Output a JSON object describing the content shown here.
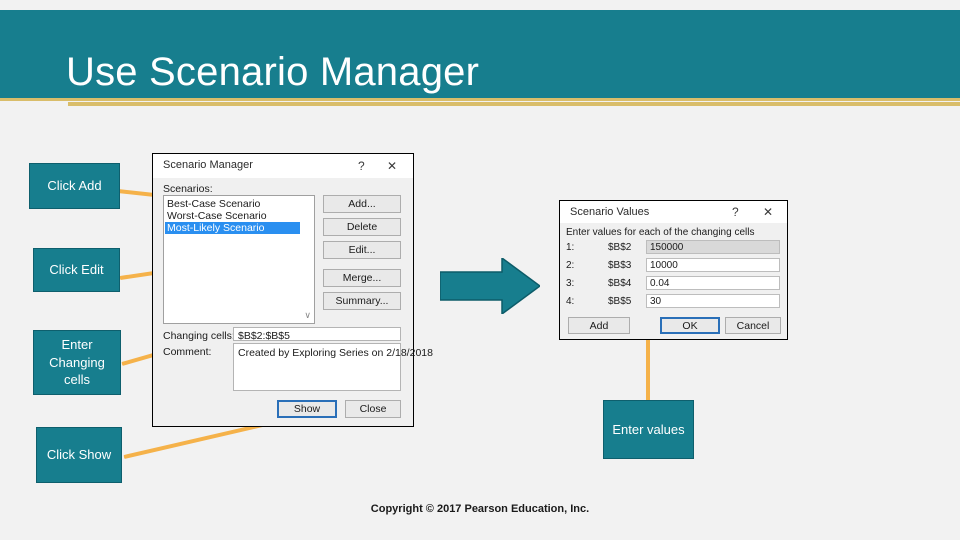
{
  "slide": {
    "title": "Use Scenario Manager",
    "copyright": "Copyright © 2017 Pearson Education, Inc.",
    "accent_teal": "#177E8E",
    "accent_gold": "#d9bd6a",
    "connector_color": "#f5b24a"
  },
  "callouts": [
    {
      "id": "click-add",
      "label": "Click Add"
    },
    {
      "id": "click-edit",
      "label": "Click Edit"
    },
    {
      "id": "enter-changing",
      "label": "Enter Changing cells"
    },
    {
      "id": "click-show",
      "label": "Click Show"
    },
    {
      "id": "enter-values",
      "label": "Enter values"
    }
  ],
  "scenario_manager": {
    "title": "Scenario Manager",
    "help_glyph": "?",
    "close_glyph": "✕",
    "scenarios_label": "Scenarios:",
    "scenarios": [
      {
        "name": "Best-Case Scenario",
        "selected": false
      },
      {
        "name": "Worst-Case Scenario",
        "selected": false
      },
      {
        "name": "Most-Likely Scenario",
        "selected": true
      }
    ],
    "scroll_glyph": "∨",
    "buttons": [
      {
        "label": "Add...",
        "accel": "A"
      },
      {
        "label": "Delete",
        "accel": "D"
      },
      {
        "label": "Edit...",
        "accel": "E"
      },
      {
        "label": "Merge...",
        "accel": "M"
      },
      {
        "label": "Summary...",
        "accel": "S"
      }
    ],
    "changing_cells_label": "Changing cells:",
    "changing_cells_value": "$B$2:$B$5",
    "comment_label": "Comment:",
    "comment_value": "Created by Exploring Series on 2/18/2018",
    "show_button": "Show",
    "close_button": "Close"
  },
  "scenario_values": {
    "title": "Scenario Values",
    "help_glyph": "?",
    "close_glyph": "✕",
    "instruction": "Enter values for each of the changing cells",
    "rows": [
      {
        "num": "1:",
        "ref": "$B$2",
        "value": "150000",
        "selected": true
      },
      {
        "num": "2:",
        "ref": "$B$3",
        "value": "10000",
        "selected": false
      },
      {
        "num": "3:",
        "ref": "$B$4",
        "value": "0.04",
        "selected": false
      },
      {
        "num": "4:",
        "ref": "$B$5",
        "value": "30",
        "selected": false
      }
    ],
    "add_button": "Add",
    "ok_button": "OK",
    "cancel_button": "Cancel"
  }
}
